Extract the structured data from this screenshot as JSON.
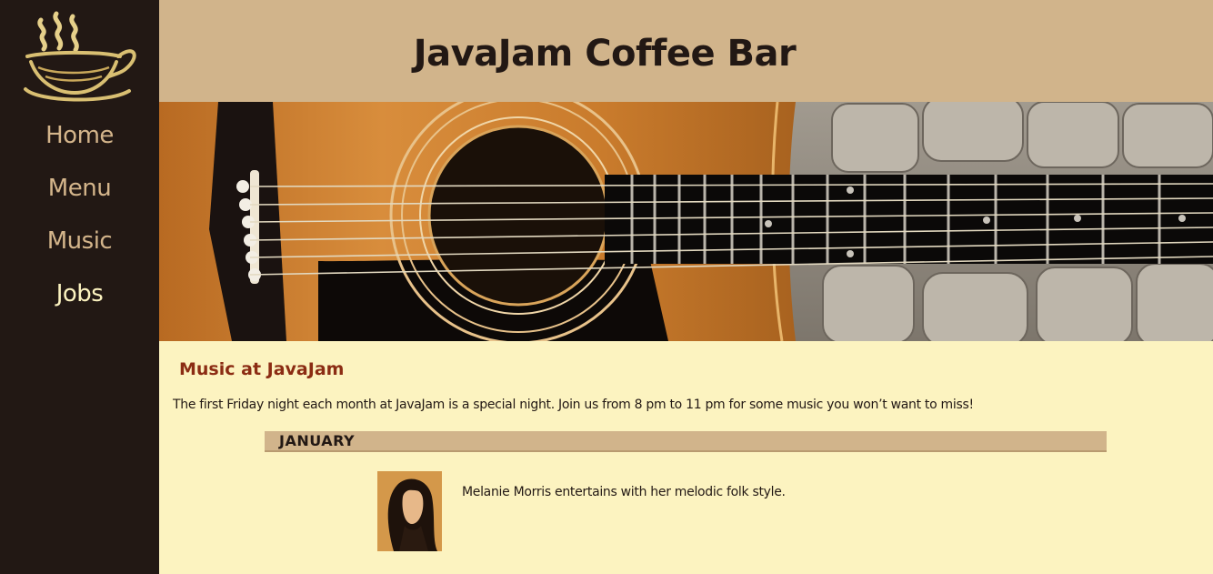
{
  "site": {
    "title": "JavaJam Coffee Bar"
  },
  "nav": {
    "items": [
      {
        "label": "Home"
      },
      {
        "label": "Menu"
      },
      {
        "label": "Music"
      },
      {
        "label": "Jobs"
      }
    ]
  },
  "hero": {
    "image": "acoustic-guitar-photo"
  },
  "main": {
    "heading": "Music at JavaJam",
    "intro": "The first Friday night each month at JavaJam is a special night. Join us from 8 pm to 11 pm for some music you won’t want to miss!",
    "events": [
      {
        "month": "JANUARY",
        "description": "Melanie Morris entertains with her melodic folk style."
      }
    ]
  },
  "colors": {
    "sidebar": "#221814",
    "header": "#d1b48b",
    "content_bg": "#fcf3c0",
    "heading": "#8b2c13",
    "nav_link": "#d4b58b"
  }
}
